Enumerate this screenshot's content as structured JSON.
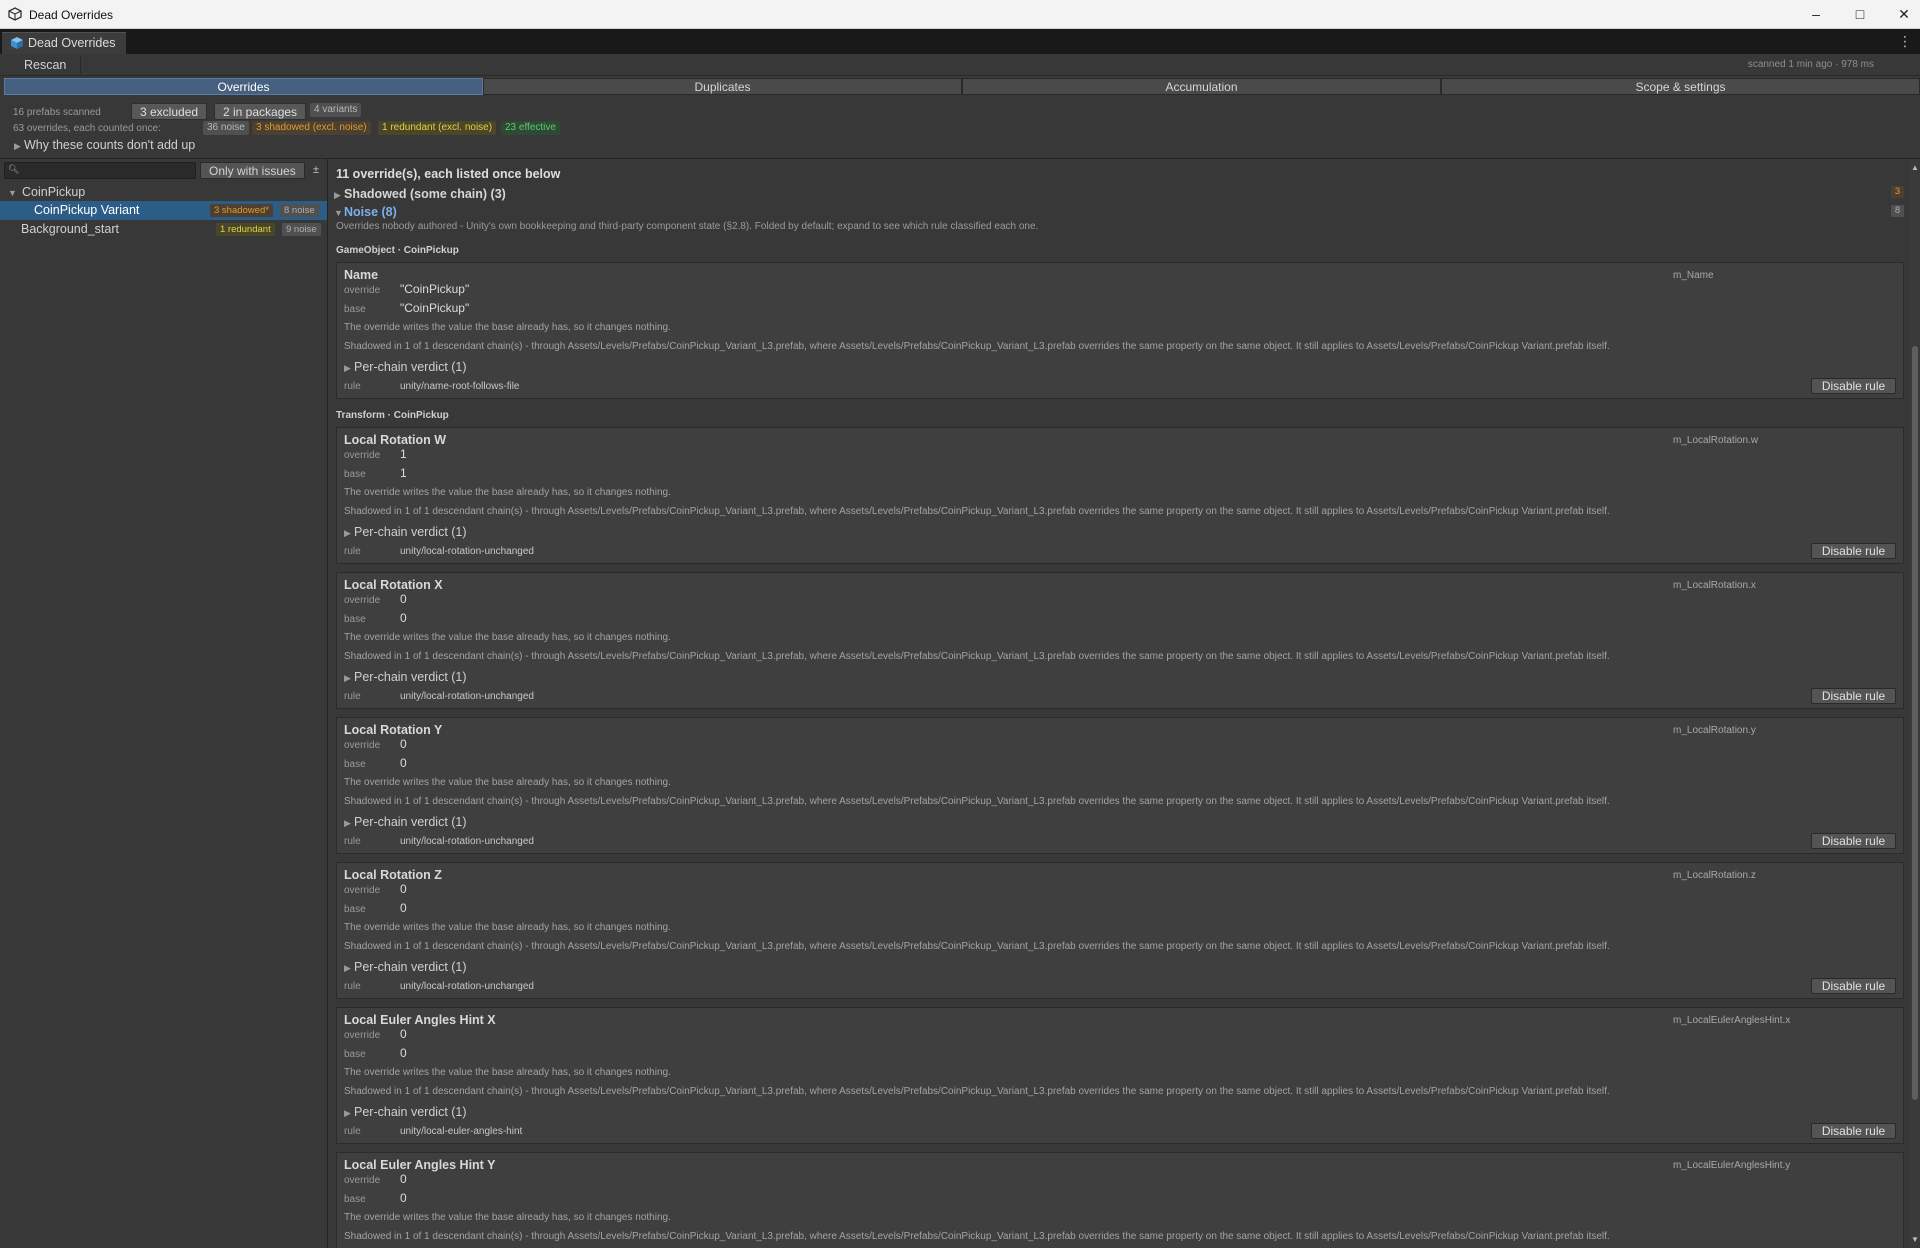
{
  "window": {
    "title": "Dead Overrides",
    "buttons": [
      "–",
      "□",
      "✕"
    ]
  },
  "editor_tab": {
    "label": "Dead Overrides",
    "menu_glyph": "⋮"
  },
  "toolbar": {
    "rescan_label": "Rescan",
    "scan_status": "scanned 1 min ago · 978 ms"
  },
  "main_tabs": [
    {
      "label": "Overrides",
      "active": true
    },
    {
      "label": "Duplicates",
      "active": false
    },
    {
      "label": "Accumulation",
      "active": false
    },
    {
      "label": "Scope & settings",
      "active": false
    }
  ],
  "stats": {
    "prefabs_scanned": "16 prefabs scanned",
    "excluded": "3 excluded",
    "in_packages": "2 in packages",
    "variants": "4 variants",
    "overrides_once": "63 overrides, each counted once:",
    "noise": "36 noise",
    "shadowed": "3 shadowed (excl. noise)",
    "redundant": "1 redundant (excl. noise)",
    "effective": "23 effective",
    "why_label": "Why these counts don't add up"
  },
  "colors": {
    "accent_tab": "#46607f",
    "selection": "#2c5d87",
    "shadowed": "#e39a2f",
    "redundant": "#e2d146",
    "effective": "#5fc76f",
    "noise_link": "#7ab0ee"
  },
  "left": {
    "search_placeholder": "",
    "only_issues_label": "Only with issues",
    "sort_glyph": "±",
    "tree": [
      {
        "label": "CoinPickup",
        "expanded": true,
        "chips": []
      },
      {
        "label": "CoinPickup Variant",
        "selected": true,
        "chips": [
          "3 shadowed*",
          "8 noise"
        ]
      },
      {
        "label": "Background_start",
        "chips": [
          "1 redundant",
          "9 noise"
        ]
      }
    ]
  },
  "content": {
    "heading": "11 override(s), each listed once below",
    "groups": [
      {
        "label": "Shadowed (some chain)  (3)",
        "count": "3"
      },
      {
        "label": "Noise  (8)",
        "count": "8"
      }
    ],
    "noise_desc": "Overrides nobody authored - Unity's own bookkeeping and third-party component state (§2.8). Folded by default; expand to see which rule classified each one.",
    "labels": {
      "override": "override",
      "base": "base",
      "rule": "rule",
      "per_chain": "Per-chain verdict (1)",
      "disable": "Disable rule",
      "no_change": "The override writes the value the base already has, so it changes nothing.",
      "shadowed": "Shadowed in 1 of 1 descendant chain(s) - through Assets/Levels/Prefabs/CoinPickup_Variant_L3.prefab, where Assets/Levels/Prefabs/CoinPickup_Variant_L3.prefab overrides the same property on the same object. It still applies to Assets/Levels/Prefabs/CoinPickup Variant.prefab itself."
    },
    "sections": [
      {
        "title": "GameObject · CoinPickup"
      },
      {
        "title": "Transform · CoinPickup"
      }
    ],
    "cards": [
      {
        "name": "Name",
        "prop": "m_Name",
        "override": "\"CoinPickup\"",
        "base": "\"CoinPickup\"",
        "rule": "unity/name-root-follows-file"
      },
      {
        "name": "Local Rotation W",
        "prop": "m_LocalRotation.w",
        "override": "1",
        "base": "1",
        "rule": "unity/local-rotation-unchanged"
      },
      {
        "name": "Local Rotation X",
        "prop": "m_LocalRotation.x",
        "override": "0",
        "base": "0",
        "rule": "unity/local-rotation-unchanged"
      },
      {
        "name": "Local Rotation Y",
        "prop": "m_LocalRotation.y",
        "override": "0",
        "base": "0",
        "rule": "unity/local-rotation-unchanged"
      },
      {
        "name": "Local Rotation Z",
        "prop": "m_LocalRotation.z",
        "override": "0",
        "base": "0",
        "rule": "unity/local-rotation-unchanged"
      },
      {
        "name": "Local Euler Angles Hint X",
        "prop": "m_LocalEulerAnglesHint.x",
        "override": "0",
        "base": "0",
        "rule": "unity/local-euler-angles-hint"
      },
      {
        "name": "Local Euler Angles Hint Y",
        "prop": "m_LocalEulerAnglesHint.y",
        "override": "0",
        "base": "0",
        "rule": ""
      }
    ]
  }
}
